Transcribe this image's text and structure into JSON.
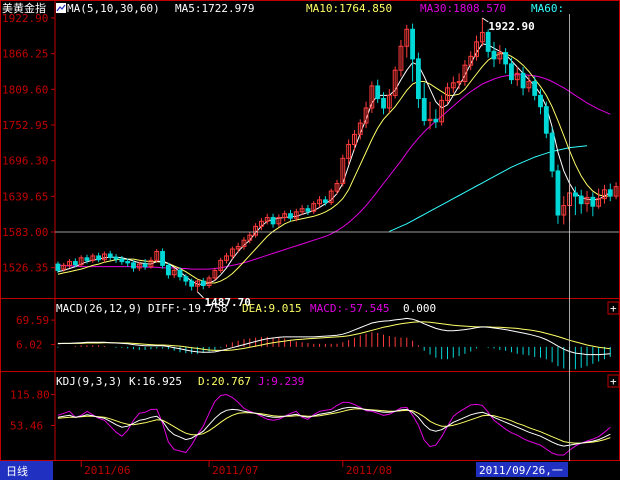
{
  "colors": {
    "background": "#000000",
    "frame": "#c00000",
    "axis_text": "#c00000",
    "up_candle": "#ff3c3c",
    "down_candle": "#00d8d8",
    "ma5": "#ffffff",
    "ma10": "#ffff66",
    "ma30": "#e000e0",
    "ma60": "#33ffff",
    "dif": "#ffffff",
    "dea": "#ffff66",
    "macd_pos": "#ff3c3c",
    "macd_neg": "#00d8d8",
    "k": "#ffffff",
    "d": "#ffff66",
    "j": "#e000e0",
    "crosshair": "#d0d0d0",
    "date_box_bg": "#2030c0"
  },
  "price_panel": {
    "symbol": "美黄金指",
    "indicator_icon": "chart-indicator-icon",
    "ma_params": "MA(5,10,30,60)",
    "ma5": "MA5:1722.979",
    "ma10": "MA10:1764.850",
    "ma30": "MA30:1808.570",
    "ma60": "MA60:",
    "y_ticks": [
      "1922.90",
      "1866.25",
      "1809.60",
      "1752.95",
      "1696.30",
      "1639.65",
      "1583.00",
      "1526.35"
    ],
    "high_label": "1922.90",
    "low_label": "1487.70"
  },
  "macd_panel": {
    "title": "MACD(26,12,9)",
    "diff": "DIFF:-19.758",
    "dea": "DEA:9.015",
    "macd": "MACD:-57.545",
    "zero": "0.000",
    "y_ticks": [
      "69.59",
      "6.02"
    ]
  },
  "kdj_panel": {
    "title": "KDJ(9,3,3)",
    "k": "K:16.925",
    "d": "D:20.767",
    "j": "J:9.239",
    "y_ticks": [
      "115.80",
      "53.46"
    ]
  },
  "footer": {
    "period": "日线",
    "months": [
      "2011/06",
      "2011/07",
      "2011/08"
    ],
    "crosshair_date": "2011/09/26,一"
  },
  "panel_buttons": [
    "+",
    "+"
  ],
  "chart_data": {
    "type": "candlestick",
    "y_range": [
      1487.7,
      1922.9
    ],
    "hline_price": 1583.0,
    "crosshair_index": 88,
    "candles": [
      [
        1532,
        1522,
        1536,
        1518
      ],
      [
        1524,
        1530,
        1534,
        1520
      ],
      [
        1530,
        1536,
        1540,
        1526
      ],
      [
        1536,
        1531,
        1541,
        1527
      ],
      [
        1531,
        1542,
        1546,
        1528
      ],
      [
        1542,
        1538,
        1547,
        1533
      ],
      [
        1538,
        1545,
        1549,
        1534
      ],
      [
        1545,
        1539,
        1550,
        1535
      ],
      [
        1539,
        1548,
        1552,
        1535
      ],
      [
        1548,
        1543,
        1553,
        1538
      ],
      [
        1543,
        1540,
        1548,
        1534
      ],
      [
        1540,
        1536,
        1545,
        1531
      ],
      [
        1536,
        1534,
        1541,
        1528
      ],
      [
        1534,
        1526,
        1538,
        1520
      ],
      [
        1526,
        1532,
        1536,
        1521
      ],
      [
        1532,
        1528,
        1540,
        1523
      ],
      [
        1528,
        1538,
        1543,
        1525
      ],
      [
        1538,
        1552,
        1556,
        1534
      ],
      [
        1552,
        1530,
        1557,
        1525
      ],
      [
        1530,
        1515,
        1534,
        1509
      ],
      [
        1515,
        1522,
        1526,
        1510
      ],
      [
        1522,
        1512,
        1527,
        1506
      ],
      [
        1512,
        1505,
        1516,
        1498
      ],
      [
        1505,
        1497,
        1509,
        1490
      ],
      [
        1497,
        1505,
        1508,
        1488
      ],
      [
        1505,
        1498,
        1510,
        1492
      ],
      [
        1498,
        1510,
        1514,
        1494
      ],
      [
        1510,
        1522,
        1526,
        1506
      ],
      [
        1522,
        1538,
        1542,
        1518
      ],
      [
        1538,
        1545,
        1550,
        1533
      ],
      [
        1545,
        1556,
        1560,
        1540
      ],
      [
        1556,
        1560,
        1566,
        1550
      ],
      [
        1560,
        1570,
        1575,
        1555
      ],
      [
        1570,
        1578,
        1583,
        1565
      ],
      [
        1578,
        1592,
        1597,
        1574
      ],
      [
        1592,
        1600,
        1605,
        1586
      ],
      [
        1600,
        1606,
        1612,
        1595
      ],
      [
        1606,
        1596,
        1612,
        1590
      ],
      [
        1596,
        1606,
        1611,
        1591
      ],
      [
        1606,
        1612,
        1617,
        1600
      ],
      [
        1612,
        1605,
        1618,
        1600
      ],
      [
        1605,
        1615,
        1620,
        1600
      ],
      [
        1615,
        1620,
        1626,
        1610
      ],
      [
        1620,
        1616,
        1626,
        1610
      ],
      [
        1616,
        1628,
        1632,
        1612
      ],
      [
        1628,
        1634,
        1640,
        1622
      ],
      [
        1634,
        1630,
        1640,
        1625
      ],
      [
        1630,
        1648,
        1652,
        1626
      ],
      [
        1648,
        1660,
        1666,
        1643
      ],
      [
        1660,
        1700,
        1706,
        1655
      ],
      [
        1700,
        1722,
        1730,
        1690
      ],
      [
        1722,
        1738,
        1745,
        1712
      ],
      [
        1738,
        1756,
        1762,
        1730
      ],
      [
        1756,
        1780,
        1790,
        1748
      ],
      [
        1780,
        1815,
        1822,
        1772
      ],
      [
        1815,
        1795,
        1825,
        1788
      ],
      [
        1795,
        1780,
        1805,
        1770
      ],
      [
        1780,
        1800,
        1810,
        1772
      ],
      [
        1800,
        1840,
        1846,
        1795
      ],
      [
        1840,
        1878,
        1888,
        1830
      ],
      [
        1878,
        1905,
        1912,
        1860
      ],
      [
        1905,
        1858,
        1914,
        1822
      ],
      [
        1858,
        1795,
        1868,
        1780
      ],
      [
        1795,
        1760,
        1820,
        1752
      ],
      [
        1760,
        1762,
        1790,
        1746
      ],
      [
        1762,
        1758,
        1778,
        1748
      ],
      [
        1758,
        1792,
        1800,
        1752
      ],
      [
        1792,
        1812,
        1820,
        1786
      ],
      [
        1812,
        1820,
        1830,
        1804
      ],
      [
        1820,
        1822,
        1835,
        1810
      ],
      [
        1822,
        1848,
        1856,
        1815
      ],
      [
        1848,
        1862,
        1870,
        1840
      ],
      [
        1862,
        1885,
        1895,
        1855
      ],
      [
        1885,
        1900,
        1922.9,
        1878
      ],
      [
        1900,
        1870,
        1905,
        1860
      ],
      [
        1870,
        1858,
        1885,
        1845
      ],
      [
        1858,
        1868,
        1880,
        1850
      ],
      [
        1868,
        1850,
        1875,
        1835
      ],
      [
        1850,
        1825,
        1860,
        1818
      ],
      [
        1825,
        1835,
        1846,
        1815
      ],
      [
        1835,
        1812,
        1845,
        1800
      ],
      [
        1812,
        1822,
        1832,
        1805
      ],
      [
        1822,
        1800,
        1830,
        1792
      ],
      [
        1800,
        1782,
        1810,
        1770
      ],
      [
        1782,
        1740,
        1790,
        1732
      ],
      [
        1740,
        1680,
        1750,
        1670
      ],
      [
        1680,
        1610,
        1690,
        1596
      ],
      [
        1610,
        1625,
        1640,
        1595
      ],
      [
        1625,
        1645,
        1660,
        1600
      ],
      [
        1645,
        1640,
        1655,
        1610
      ],
      [
        1640,
        1628,
        1650,
        1612
      ],
      [
        1628,
        1638,
        1648,
        1615
      ],
      [
        1638,
        1624,
        1646,
        1608
      ],
      [
        1624,
        1636,
        1652,
        1620
      ],
      [
        1636,
        1650,
        1658,
        1628
      ],
      [
        1650,
        1640,
        1660,
        1632
      ],
      [
        1640,
        1655,
        1662,
        1635
      ]
    ],
    "ma5": [
      1520,
      1522,
      1525,
      1528,
      1532,
      1536,
      1538,
      1540,
      1542,
      1543,
      1543,
      1542,
      1540,
      1537,
      1534,
      1533,
      1532,
      1536,
      1537,
      1533,
      1527,
      1520,
      1512,
      1505,
      1500,
      1500,
      1502,
      1506,
      1515,
      1526,
      1540,
      1552,
      1562,
      1570,
      1582,
      1592,
      1600,
      1603,
      1605,
      1606,
      1607,
      1608,
      1611,
      1614,
      1617,
      1622,
      1628,
      1634,
      1644,
      1660,
      1688,
      1715,
      1740,
      1762,
      1788,
      1800,
      1800,
      1800,
      1808,
      1825,
      1840,
      1852,
      1848,
      1830,
      1810,
      1790,
      1780,
      1785,
      1800,
      1815,
      1832,
      1850,
      1868,
      1882,
      1880,
      1875,
      1870,
      1865,
      1855,
      1845,
      1835,
      1825,
      1815,
      1802,
      1782,
      1750,
      1710,
      1680,
      1660,
      1645,
      1638,
      1635,
      1634,
      1635,
      1640,
      1646
    ],
    "ma10": [
      1516,
      1518,
      1520,
      1522,
      1524,
      1527,
      1530,
      1532,
      1535,
      1537,
      1539,
      1540,
      1540,
      1540,
      1538,
      1537,
      1536,
      1536,
      1535,
      1533,
      1529,
      1525,
      1520,
      1514,
      1508,
      1505,
      1502,
      1502,
      1505,
      1510,
      1517,
      1526,
      1536,
      1546,
      1556,
      1566,
      1576,
      1584,
      1590,
      1596,
      1600,
      1602,
      1604,
      1606,
      1608,
      1611,
      1615,
      1620,
      1627,
      1636,
      1650,
      1670,
      1690,
      1710,
      1730,
      1748,
      1762,
      1772,
      1782,
      1795,
      1808,
      1818,
      1822,
      1822,
      1818,
      1812,
      1806,
      1800,
      1800,
      1802,
      1810,
      1822,
      1834,
      1846,
      1856,
      1862,
      1866,
      1866,
      1862,
      1856,
      1848,
      1838,
      1826,
      1814,
      1800,
      1782,
      1760,
      1736,
      1712,
      1690,
      1672,
      1658,
      1648,
      1642,
      1640,
      1640
    ],
    "ma30": [
      1530,
      1530,
      1529,
      1529,
      1528,
      1528,
      1528,
      1528,
      1528,
      1528,
      1528,
      1528,
      1528,
      1528,
      1528,
      1527,
      1527,
      1527,
      1526,
      1526,
      1526,
      1525,
      1525,
      1524,
      1524,
      1524,
      1524,
      1525,
      1526,
      1528,
      1530,
      1532,
      1534,
      1537,
      1540,
      1543,
      1546,
      1549,
      1552,
      1555,
      1558,
      1561,
      1564,
      1567,
      1570,
      1573,
      1576,
      1580,
      1585,
      1591,
      1598,
      1606,
      1615,
      1625,
      1636,
      1648,
      1660,
      1672,
      1684,
      1696,
      1709,
      1721,
      1732,
      1742,
      1751,
      1759,
      1767,
      1775,
      1783,
      1791,
      1799,
      1806,
      1812,
      1818,
      1822,
      1826,
      1829,
      1831,
      1832,
      1833,
      1833,
      1832,
      1831,
      1829,
      1826,
      1822,
      1817,
      1812,
      1806,
      1800,
      1794,
      1788,
      1783,
      1778,
      1774,
      1770
    ],
    "ma60": [
      null,
      null,
      null,
      null,
      null,
      null,
      null,
      null,
      null,
      null,
      null,
      null,
      null,
      null,
      null,
      null,
      null,
      null,
      null,
      null,
      null,
      null,
      null,
      null,
      null,
      null,
      null,
      null,
      null,
      null,
      null,
      null,
      null,
      null,
      null,
      null,
      null,
      null,
      null,
      null,
      null,
      null,
      null,
      null,
      null,
      null,
      null,
      null,
      null,
      null,
      null,
      null,
      null,
      null,
      null,
      null,
      null,
      1584,
      1588,
      1592,
      1596,
      1601,
      1606,
      1611,
      1616,
      1621,
      1626,
      1631,
      1636,
      1641,
      1646,
      1651,
      1656,
      1661,
      1666,
      1671,
      1676,
      1681,
      1686,
      1690,
      1694,
      1698,
      1702,
      1705,
      1708,
      1711,
      1713,
      1715,
      1717,
      1718,
      1719,
      1720
    ],
    "macd_range": [
      -60,
      75
    ],
    "dif": [
      8,
      9,
      9,
      10,
      11,
      12,
      12,
      12,
      12,
      11,
      10,
      9,
      8,
      6,
      4,
      3,
      3,
      3,
      3,
      1,
      -2,
      -5,
      -8,
      -11,
      -13,
      -14,
      -14,
      -13,
      -10,
      -6,
      -2,
      2,
      6,
      10,
      14,
      18,
      21,
      23,
      25,
      26,
      26,
      26,
      26,
      26,
      26,
      27,
      28,
      29,
      30,
      33,
      38,
      44,
      50,
      56,
      62,
      65,
      67,
      68,
      70,
      72,
      74,
      72,
      67,
      60,
      54,
      48,
      44,
      42,
      42,
      43,
      45,
      47,
      50,
      52,
      51,
      49,
      47,
      45,
      42,
      39,
      36,
      33,
      29,
      25,
      19,
      11,
      2,
      -6,
      -12,
      -16,
      -18,
      -20,
      -20,
      -20,
      -19,
      -18
    ],
    "dea": [
      9,
      9,
      9,
      9,
      9,
      10,
      10,
      10,
      11,
      11,
      11,
      10,
      10,
      9,
      8,
      7,
      6,
      5,
      5,
      4,
      3,
      2,
      0,
      -2,
      -4,
      -6,
      -8,
      -9,
      -9,
      -9,
      -8,
      -6,
      -4,
      -1,
      2,
      5,
      8,
      11,
      13,
      15,
      17,
      19,
      20,
      21,
      22,
      23,
      24,
      25,
      26,
      27,
      29,
      32,
      35,
      39,
      43,
      47,
      51,
      54,
      57,
      60,
      62,
      64,
      65,
      65,
      64,
      62,
      60,
      58,
      56,
      55,
      54,
      53,
      52,
      52,
      52,
      51,
      51,
      50,
      49,
      48,
      46,
      44,
      42,
      39,
      35,
      31,
      27,
      22,
      17,
      13,
      9,
      5,
      2,
      -1,
      -3,
      -5
    ],
    "kdj_range": [
      -10,
      125
    ],
    "k": [
      70,
      72,
      74,
      70,
      72,
      75,
      73,
      70,
      68,
      62,
      55,
      50,
      52,
      58,
      64,
      66,
      70,
      72,
      62,
      45,
      35,
      30,
      25,
      28,
      35,
      42,
      55,
      68,
      78,
      84,
      86,
      85,
      82,
      80,
      78,
      75,
      72,
      70,
      70,
      72,
      74,
      76,
      72,
      70,
      73,
      76,
      78,
      80,
      84,
      88,
      90,
      90,
      88,
      85,
      84,
      82,
      80,
      80,
      82,
      85,
      86,
      80,
      70,
      55,
      45,
      42,
      45,
      52,
      60,
      65,
      70,
      75,
      78,
      80,
      76,
      70,
      65,
      60,
      55,
      50,
      45,
      40,
      36,
      32,
      26,
      20,
      15,
      12,
      14,
      16,
      18,
      20,
      22,
      25,
      30,
      36
    ],
    "d": [
      68,
      69,
      70,
      70,
      71,
      72,
      72,
      71,
      70,
      67,
      63,
      59,
      56,
      55,
      57,
      59,
      62,
      65,
      64,
      58,
      51,
      44,
      38,
      35,
      35,
      37,
      43,
      51,
      60,
      68,
      74,
      78,
      79,
      79,
      78,
      77,
      75,
      73,
      72,
      72,
      72,
      73,
      73,
      72,
      72,
      73,
      75,
      77,
      79,
      82,
      85,
      87,
      87,
      86,
      85,
      84,
      83,
      82,
      82,
      83,
      84,
      83,
      78,
      71,
      62,
      56,
      52,
      52,
      54,
      57,
      61,
      65,
      69,
      73,
      74,
      73,
      70,
      67,
      63,
      58,
      54,
      49,
      45,
      41,
      36,
      31,
      26,
      21,
      19,
      18,
      18,
      19,
      20,
      22,
      25,
      29
    ],
    "j": [
      74,
      78,
      82,
      70,
      74,
      82,
      75,
      68,
      64,
      52,
      40,
      32,
      44,
      64,
      78,
      80,
      86,
      86,
      58,
      20,
      5,
      2,
      -1,
      14,
      35,
      52,
      78,
      102,
      114,
      116,
      110,
      100,
      88,
      82,
      78,
      72,
      66,
      64,
      66,
      72,
      78,
      82,
      70,
      66,
      75,
      82,
      84,
      86,
      94,
      100,
      100,
      96,
      90,
      83,
      82,
      78,
      74,
      76,
      82,
      89,
      90,
      74,
      54,
      24,
      11,
      14,
      31,
      52,
      72,
      81,
      88,
      95,
      96,
      94,
      80,
      64,
      55,
      46,
      39,
      34,
      27,
      22,
      18,
      14,
      6,
      -2,
      -6,
      -6,
      4,
      12,
      18,
      22,
      26,
      31,
      40,
      50
    ]
  }
}
